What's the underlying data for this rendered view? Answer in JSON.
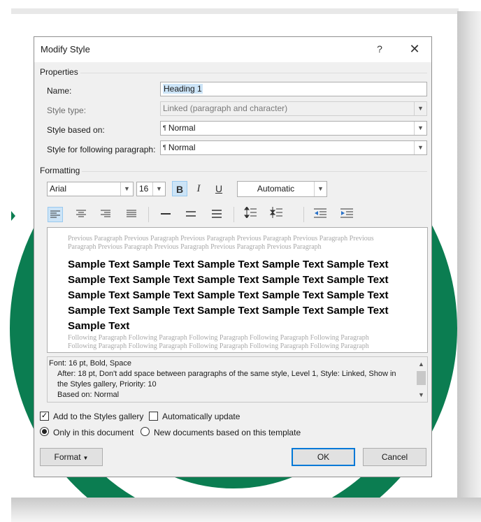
{
  "colors": {
    "accent_green": "#0b7d51",
    "dialog_bg": "#f0f0f0",
    "selection": "#cce4f7",
    "focus_blue": "#0078d7"
  },
  "dialog": {
    "title": "Modify Style",
    "help_label": "?",
    "close_label": "✕"
  },
  "properties": {
    "section_label": "Properties",
    "name_label": "Name:",
    "name_value": "Heading 1",
    "style_type_label": "Style type:",
    "style_type_value": "Linked (paragraph and character)",
    "based_on_label": "Style based on:",
    "based_on_value": "Normal",
    "following_label": "Style for following paragraph:",
    "following_value": "Normal",
    "para_mark": "¶"
  },
  "formatting": {
    "section_label": "Formatting",
    "font": "Arial",
    "size": "16",
    "bold": "B",
    "italic": "I",
    "underline": "U",
    "color": "Automatic"
  },
  "preview": {
    "previous_text": "Previous Paragraph Previous Paragraph Previous Paragraph Previous Paragraph Previous Paragraph Previous Paragraph Previous Paragraph Previous Paragraph Previous Paragraph Previous Paragraph",
    "sample_text": "Sample Text Sample Text Sample Text Sample Text Sample Text Sample Text Sample Text Sample Text Sample Text Sample Text Sample Text Sample Text Sample Text Sample Text Sample Text Sample Text Sample Text Sample Text Sample Text Sample Text Sample Text",
    "following_text": "Following Paragraph Following Paragraph Following Paragraph Following Paragraph Following Paragraph Following Paragraph Following Paragraph Following Paragraph Following Paragraph Following Paragraph"
  },
  "description": {
    "line1": "Font: 16 pt, Bold, Space",
    "line2": "After:  18 pt, Don't add space between paragraphs of the same style, Level 1, Style: Linked, Show in",
    "line3": "the Styles gallery, Priority: 10",
    "line4": "Based on: Normal"
  },
  "options": {
    "add_to_gallery_label": "Add to the Styles gallery",
    "add_to_gallery_checked": true,
    "auto_update_label": "Automatically update",
    "auto_update_checked": false,
    "only_this_doc_label": "Only in this document",
    "new_docs_label": "New documents based on this template"
  },
  "buttons": {
    "format_label": "Format",
    "ok_label": "OK",
    "cancel_label": "Cancel"
  }
}
